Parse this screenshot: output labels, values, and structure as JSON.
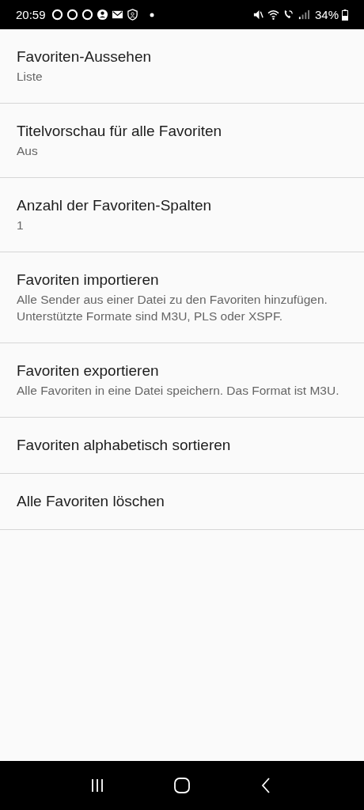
{
  "status_bar": {
    "time": "20:59",
    "battery_text": "34%"
  },
  "settings": [
    {
      "title": "Favoriten-Aussehen",
      "summary": "Liste"
    },
    {
      "title": "Titelvorschau für alle Favoriten",
      "summary": "Aus"
    },
    {
      "title": "Anzahl der Favoriten-Spalten",
      "summary": "1"
    },
    {
      "title": "Favoriten importieren",
      "summary": "Alle Sender aus einer Datei zu den Favoriten hinzufügen. Unterstützte Formate sind M3U, PLS oder XSPF."
    },
    {
      "title": "Favoriten exportieren",
      "summary": "Alle Favoriten in eine Datei speichern. Das Format ist M3U."
    },
    {
      "title": "Favoriten alphabetisch sortieren"
    },
    {
      "title": "Alle Favoriten löschen"
    }
  ]
}
